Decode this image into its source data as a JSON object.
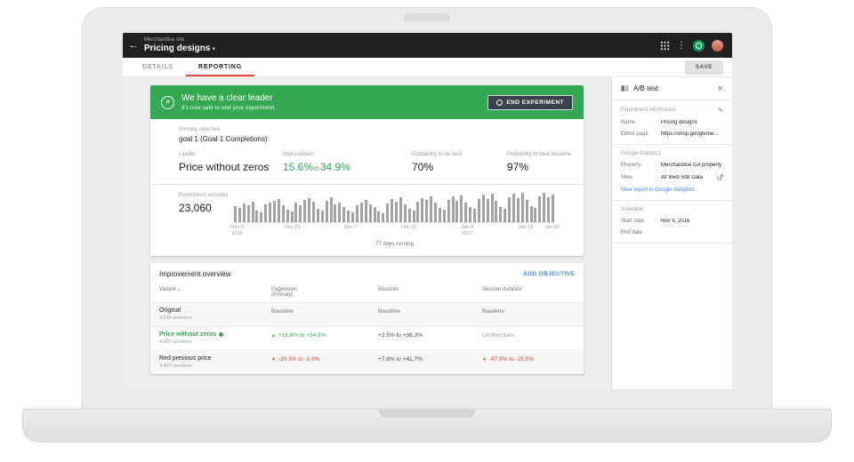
{
  "colors": {
    "banner_green": "#34a853",
    "accent_red": "#e8453c",
    "link_blue": "#4285f4",
    "negative_red": "#d23f31",
    "bar_gray": "#a3a3a3"
  },
  "icons": {
    "back": "←",
    "caret": "▾",
    "overflow": "⋮",
    "close": "✕",
    "edit": "✎",
    "sort": "↓"
  },
  "appbar": {
    "site_label": "Merchandise site",
    "title": "Pricing designs"
  },
  "tabs": {
    "details": "DETAILS",
    "reporting": "REPORTING",
    "save": "SAVE"
  },
  "banner": {
    "title": "We have a clear leader",
    "subtitle": "It's now safe to end your experiment.",
    "end_button": "END EXPERIMENT"
  },
  "objective": {
    "label": "Primary objective",
    "value": "goal 1 (Goal 1 Completions)"
  },
  "metrics": {
    "leader": {
      "label": "Leader",
      "value": "Price without zeros"
    },
    "improvement": {
      "label": "Improvement",
      "from": "15.6%",
      "joiner": "to",
      "to": "34.9%"
    },
    "prob_best": {
      "label": "Probability to be best",
      "value": "70%"
    },
    "prob_beat": {
      "label": "Probability to beat baseline",
      "value": "97%"
    }
  },
  "sessions": {
    "label": "Experiment sessions",
    "value": "23,060",
    "running_note": "77 days running",
    "axis": [
      {
        "line1": "Nov 9",
        "line2": "2016"
      },
      {
        "line1": "Nov 23",
        "line2": ""
      },
      {
        "line1": "Dec 7",
        "line2": ""
      },
      {
        "line1": "Dec 21",
        "line2": ""
      },
      {
        "line1": "Jan 4",
        "line2": "2017"
      },
      {
        "line1": "Jan 18",
        "line2": ""
      },
      {
        "line1": "Jan 25",
        "line2": ""
      }
    ],
    "bars": [
      56,
      48,
      63,
      58,
      71,
      40,
      34,
      61,
      66,
      73,
      80,
      57,
      42,
      36,
      66,
      58,
      76,
      83,
      70,
      46,
      40,
      72,
      86,
      60,
      68,
      52,
      38,
      33,
      58,
      66,
      75,
      62,
      50,
      36,
      30,
      64,
      78,
      70,
      85,
      60,
      44,
      38,
      70,
      83,
      75,
      88,
      66,
      48,
      42,
      76,
      88,
      72,
      91,
      68,
      50,
      44,
      80,
      93,
      78,
      96,
      72,
      52,
      46,
      85,
      97,
      82,
      99,
      75,
      55,
      48,
      88,
      99,
      84,
      93
    ]
  },
  "overview": {
    "title": "Improvement overview",
    "add_objective": "ADD OBJECTIVE",
    "columns": {
      "variant": "Variant",
      "pageviews_line1": "Pageviews",
      "pageviews_line2": "(Primary)",
      "bounces": "Bounces",
      "duration": "Session duration"
    },
    "rows": [
      {
        "name": "Original",
        "sessions": "4,618 sessions",
        "pageviews": "Baseline",
        "bounces": "Baseline",
        "duration": "Baseline"
      },
      {
        "name": "Price without zeros",
        "sessions": "4,609 sessions",
        "pageviews_arrow": "▲",
        "pageviews": "+15.6% to +34.9%",
        "bounces": "+2.5% to +38.3%",
        "duration": "Limited data"
      },
      {
        "name": "Red previous price",
        "sessions": "4,433 sessions",
        "pageviews_arrow": "▼",
        "pageviews": "-20.3% to -1.9%",
        "bounces": "+7.8% to +41.7%",
        "duration_arrow": "▼",
        "duration": "-87.8% to -25.5%"
      }
    ]
  },
  "sidebar": {
    "title": "A/B test",
    "experiment_info": {
      "heading": "Experiment information",
      "name_label": "Name",
      "name_value": "Pricing designs",
      "editor_label": "Editor page",
      "editor_value": "https://shop.googleme..."
    },
    "analytics": {
      "heading": "Google Analytics",
      "property_label": "Property",
      "property_value": "Merchandise GA property",
      "view_label": "View",
      "view_value": "All Web Site Data",
      "report_link": "View report in Google Analytics"
    },
    "schedule": {
      "heading": "Schedule",
      "start_label": "Start date",
      "start_value": "Nov 9, 2016",
      "end_label": "End date",
      "end_value": ""
    }
  }
}
